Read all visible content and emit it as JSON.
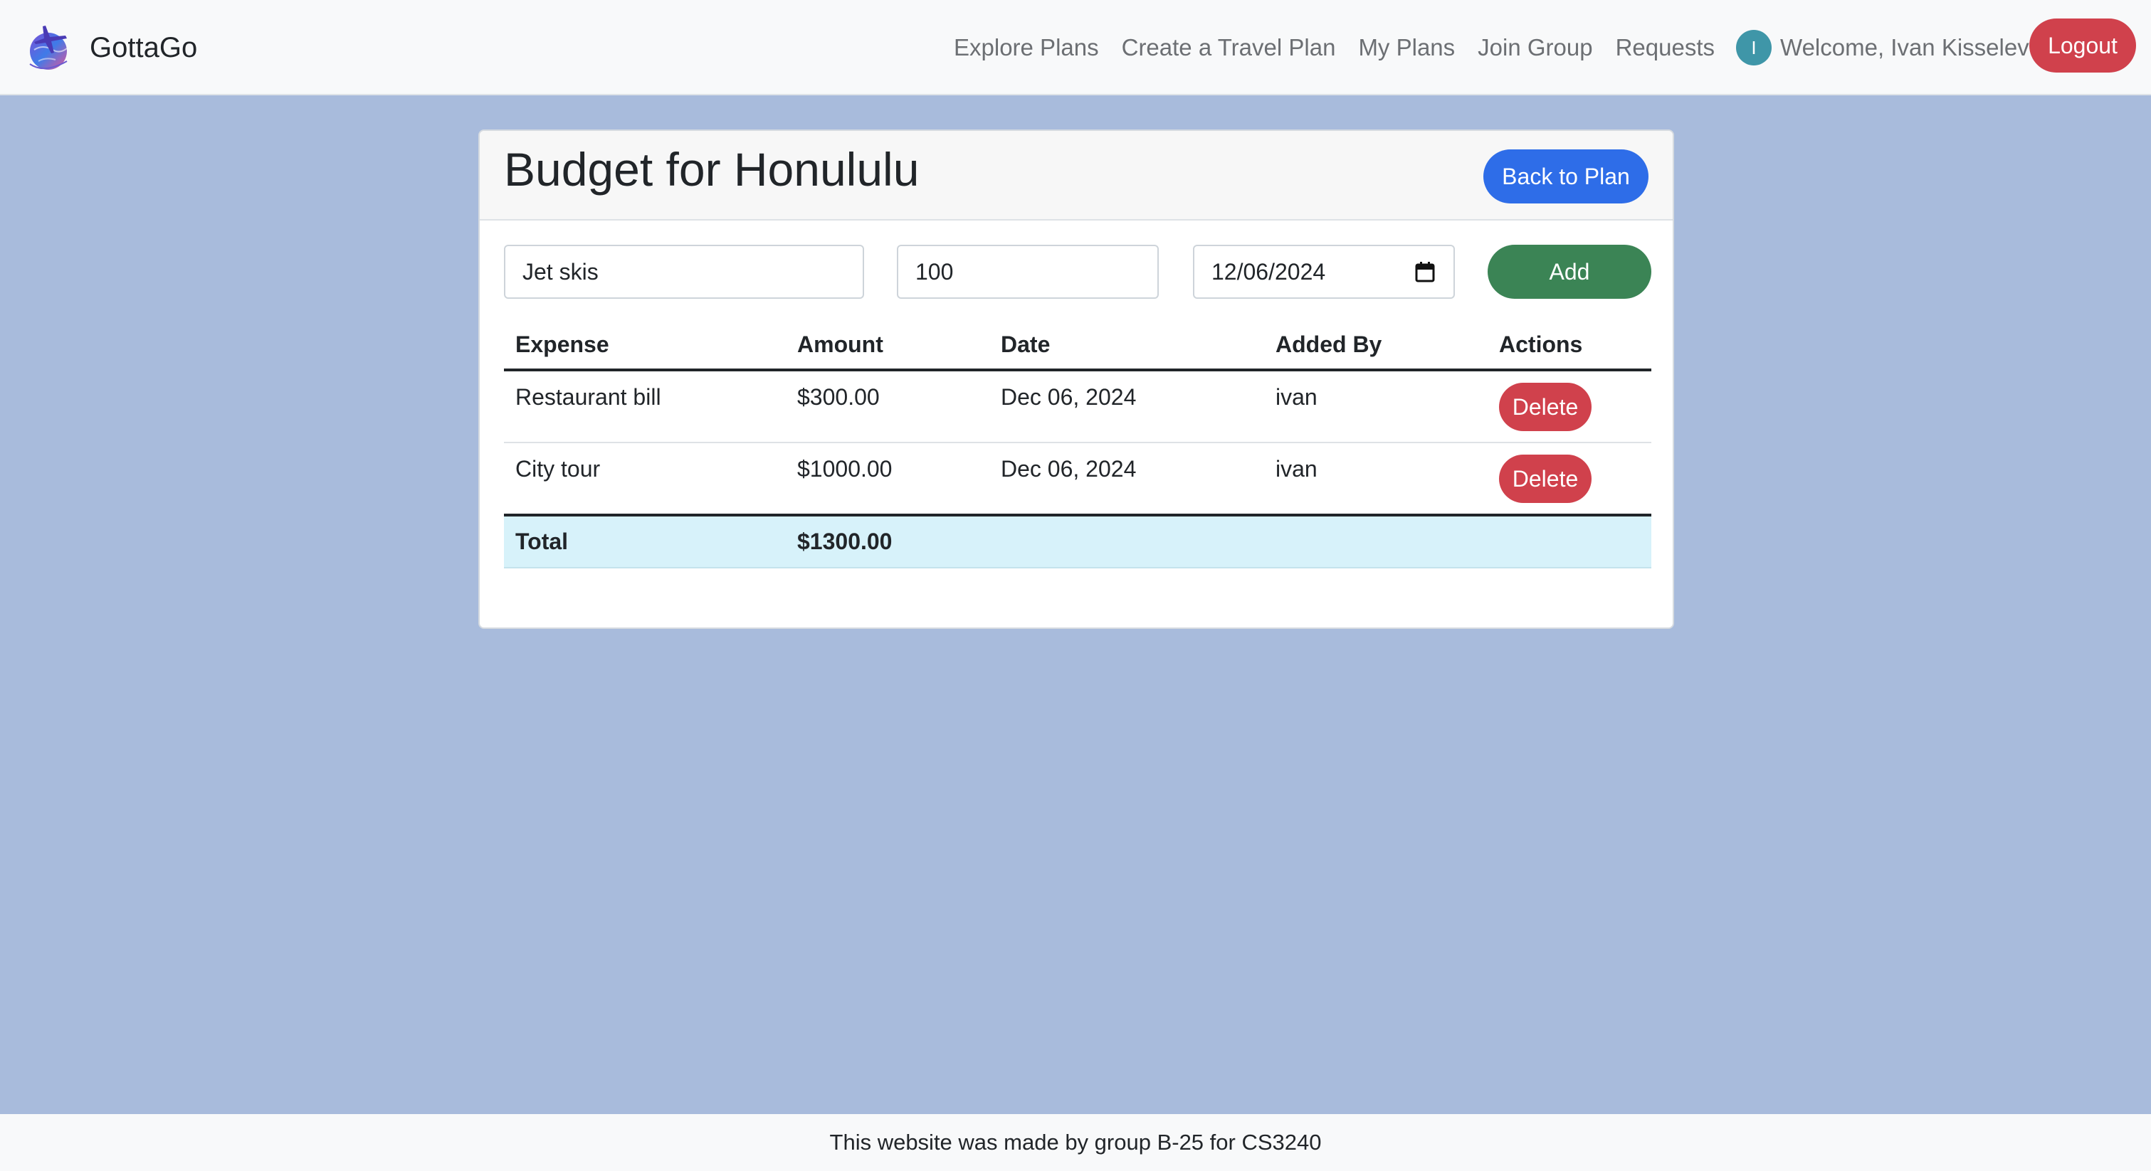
{
  "nav": {
    "brand": "GottaGo",
    "links": [
      "Explore Plans",
      "Create a Travel Plan",
      "My Plans",
      "Join Group",
      "Requests"
    ],
    "avatar_initial": "I",
    "welcome": "Welcome, Ivan Kisselev!",
    "logout": "Logout"
  },
  "card": {
    "title": "Budget for Honululu",
    "back_button": "Back to Plan"
  },
  "form": {
    "expense_value": "Jet skis",
    "amount_value": "100",
    "date_value": "12/06/2024",
    "add_button": "Add"
  },
  "table": {
    "headers": [
      "Expense",
      "Amount",
      "Date",
      "Added By",
      "Actions"
    ],
    "rows": [
      {
        "expense": "Restaurant bill",
        "amount": "$300.00",
        "date": "Dec 06, 2024",
        "added_by": "ivan",
        "action": "Delete"
      },
      {
        "expense": "City tour",
        "amount": "$1000.00",
        "date": "Dec 06, 2024",
        "added_by": "ivan",
        "action": "Delete"
      }
    ],
    "total_label": "Total",
    "total_value": "$1300.00"
  },
  "footer": {
    "text": "This website was made by group B-25 for CS3240"
  },
  "icons": {
    "logo": "globe-airplane-icon",
    "date_picker": "calendar-icon"
  },
  "colors": {
    "page_bg": "#a8bbdc",
    "primary": "#2e6de8",
    "success": "#3b8455",
    "danger": "#d0414c",
    "total_row": "#d7f2fa",
    "avatar": "#3f96a8"
  }
}
